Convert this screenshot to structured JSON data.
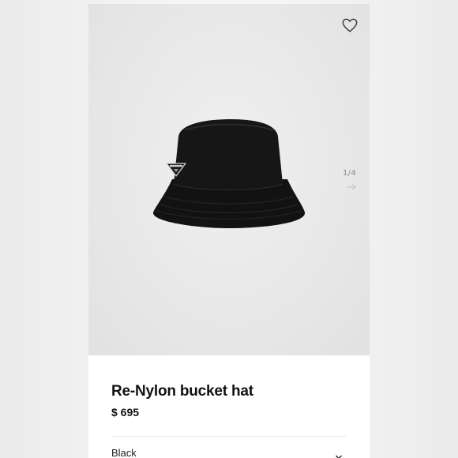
{
  "product": {
    "name": "Re-Nylon bucket hat",
    "price": "$ 695"
  },
  "gallery": {
    "counter": "1/4",
    "icons": {
      "wishlist": "heart-outline-icon",
      "next": "arrow-right-icon"
    }
  },
  "options": {
    "color": "Black",
    "color_dropdown_icon": "chevron-down-icon"
  },
  "colors": {
    "background": "#f4f4f4",
    "image_bg": "#e8e8e8",
    "text": "#111111"
  }
}
